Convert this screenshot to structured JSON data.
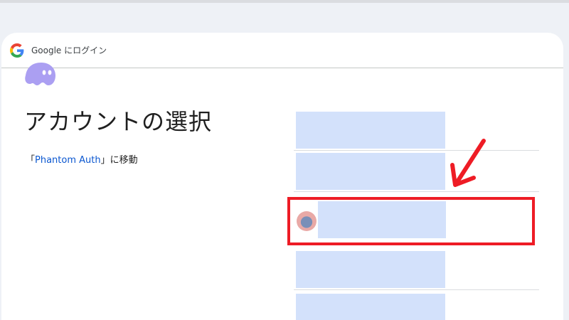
{
  "header": {
    "title": "Google にログイン",
    "logo_icon": "google-g-icon"
  },
  "main": {
    "app_logo_icon": "phantom-ghost-icon",
    "title": "アカウントの選択",
    "redirect_prefix": "「",
    "redirect_app": "Phantom Auth",
    "redirect_suffix": "」に移動"
  },
  "accounts": [
    {
      "redacted": true
    },
    {
      "redacted": true
    },
    {
      "redacted": true,
      "has_avatar": true,
      "highlighted": true
    },
    {
      "redacted": true
    },
    {
      "redacted": true
    }
  ],
  "annotation": {
    "highlight_color": "#ee1c25",
    "arrow_icon": "red-arrow-annotation"
  },
  "colors": {
    "redaction": "#d3e1fb",
    "link": "#0b57d0",
    "ghost": "#ab9ff2"
  }
}
